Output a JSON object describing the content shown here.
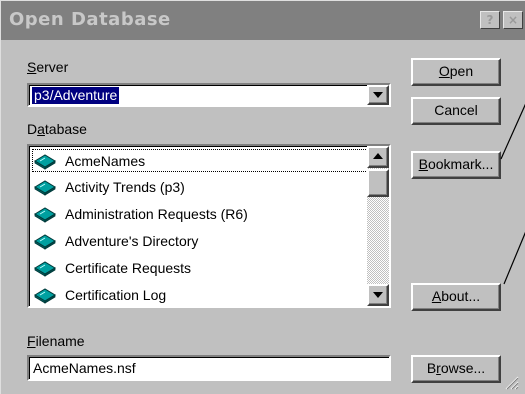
{
  "window": {
    "title": "Open Database",
    "help_btn": "?",
    "close_btn": "×"
  },
  "server": {
    "label_prefix": "",
    "label_accel": "S",
    "label_rest": "erver",
    "value": "p3/Adventure"
  },
  "database": {
    "label_prefix": "D",
    "label_accel": "a",
    "label_rest": "tabase",
    "items": [
      {
        "label": "AcmeNames",
        "icon": "database-icon",
        "selected": true
      },
      {
        "label": "Activity Trends (p3)",
        "icon": "database-icon"
      },
      {
        "label": "Administration Requests (R6)",
        "icon": "database-icon"
      },
      {
        "label": "Adventure's Directory",
        "icon": "database-icon"
      },
      {
        "label": "Certificate Requests",
        "icon": "database-icon"
      },
      {
        "label": "Certification Log",
        "icon": "database-icon"
      }
    ]
  },
  "filename": {
    "label_accel": "F",
    "label_rest": "ilename",
    "value": "AcmeNames.nsf"
  },
  "buttons": {
    "open_accel": "O",
    "open_rest": "pen",
    "cancel": "Cancel",
    "bookmark_accel": "B",
    "bookmark_rest": "ookmark...",
    "about_accel": "A",
    "about_rest": "bout...",
    "browse_pre": "B",
    "browse_accel": "r",
    "browse_rest": "owse..."
  },
  "colors": {
    "dialog_face": "#c0c0c0",
    "titlebar": "#808080",
    "selection": "#000080",
    "icon_teal": "#008080"
  }
}
